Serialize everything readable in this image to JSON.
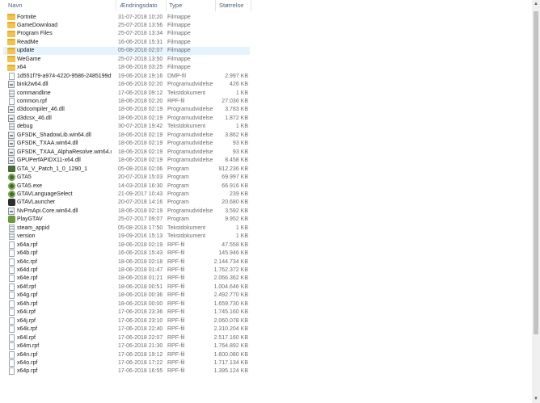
{
  "columns": {
    "name": "Navn",
    "date": "Ændringsdato",
    "type": "Type",
    "size": "Størrelse"
  },
  "files": [
    {
      "name": "Fortnite",
      "date": "31-07-2018 10:20",
      "type": "Filmappe",
      "size": "",
      "icon": "folder-icon"
    },
    {
      "name": "GameDownload",
      "date": "25-07-2018 13:56",
      "type": "Filmappe",
      "size": "",
      "icon": "folder-icon"
    },
    {
      "name": "Program Files",
      "date": "25-07-2018 13:34",
      "type": "Filmappe",
      "size": "",
      "icon": "folder-icon"
    },
    {
      "name": "ReadMe",
      "date": "16-06-2018 15:31",
      "type": "Filmappe",
      "size": "",
      "icon": "folder-icon"
    },
    {
      "name": "update",
      "date": "05-08-2018 02:07",
      "type": "Filmappe",
      "size": "",
      "icon": "folder-icon",
      "selected": true
    },
    {
      "name": "WeGame",
      "date": "25-07-2018 13:50",
      "type": "Filmappe",
      "size": "",
      "icon": "folder-icon"
    },
    {
      "name": "x64",
      "date": "18-06-2018 03:25",
      "type": "Filmappe",
      "size": "",
      "icon": "folder-icon"
    },
    {
      "name": "1d551f79-a974-4220-9586-2485199df9e2...",
      "date": "19-06-2018 19:16",
      "type": "DMP-fil",
      "size": "2.997 KB",
      "icon": "file-icon"
    },
    {
      "name": "bink2w64.dll",
      "date": "18-06-2018 02:20",
      "type": "Programudvidelse",
      "size": "426 KB",
      "icon": "dll-icon"
    },
    {
      "name": "commandline",
      "date": "17-06-2018 09:12",
      "type": "Tekstdokument",
      "size": "1 KB",
      "icon": "text-file-icon"
    },
    {
      "name": "common.rpf",
      "date": "18-06-2018 02:20",
      "type": "RPF-fil",
      "size": "27.036 KB",
      "icon": "file-icon"
    },
    {
      "name": "d3dcompiler_46.dll",
      "date": "18-06-2018 02:19",
      "type": "Programudvidelse",
      "size": "3.783 KB",
      "icon": "dll-icon"
    },
    {
      "name": "d3dcsx_46.dll",
      "date": "18-06-2018 02:19",
      "type": "Programudvidelse",
      "size": "1.872 KB",
      "icon": "dll-icon"
    },
    {
      "name": "debug",
      "date": "30-07-2018 19:42",
      "type": "Tekstdokument",
      "size": "1 KB",
      "icon": "text-file-icon"
    },
    {
      "name": "GFSDK_ShadowLib.win64.dll",
      "date": "18-06-2018 02:19",
      "type": "Programudvidelse",
      "size": "3.862 KB",
      "icon": "dll-icon"
    },
    {
      "name": "GFSDK_TXAA.win64.dll",
      "date": "18-06-2018 02:19",
      "type": "Programudvidelse",
      "size": "93 KB",
      "icon": "dll-icon"
    },
    {
      "name": "GFSDK_TXAA_AlphaResolve.win64.dll",
      "date": "18-06-2018 02:19",
      "type": "Programudvidelse",
      "size": "93 KB",
      "icon": "dll-icon"
    },
    {
      "name": "GPUPerfAPIDX11-x64.dll",
      "date": "18-06-2018 02:19",
      "type": "Programudvidelse",
      "size": "8.458 KB",
      "icon": "dll-icon"
    },
    {
      "name": "GTA_V_Patch_1_0_1290_1",
      "date": "05-08-2018 02:06",
      "type": "Program",
      "size": "912.236 KB",
      "icon": "exe-icon"
    },
    {
      "name": "GTA5",
      "date": "20-07-2018 15:03",
      "type": "Program",
      "size": "69.997 KB",
      "icon": "gta5-icon"
    },
    {
      "name": "GTA5.exe",
      "date": "14-03-2018 16:30",
      "type": "Program",
      "size": "66.916 KB",
      "icon": "gta5-icon"
    },
    {
      "name": "GTAVLanguageSelect",
      "date": "21-09-2017 10:43",
      "type": "Program",
      "size": "239 KB",
      "icon": "gta5-icon"
    },
    {
      "name": "GTAVLauncher",
      "date": "20-07-2018 14:16",
      "type": "Program",
      "size": "20.680 KB",
      "icon": "launcher-icon"
    },
    {
      "name": "NvPmApi.Core.win64.dll",
      "date": "18-06-2018 02:19",
      "type": "Programudvidelse",
      "size": "3.592 KB",
      "icon": "dll-icon"
    },
    {
      "name": "PlayGTAV",
      "date": "25-07-2017 09:07",
      "type": "Program",
      "size": "9.952 KB",
      "icon": "play-icon"
    },
    {
      "name": "steam_appid",
      "date": "05-08-2018 17:50",
      "type": "Tekstdokument",
      "size": "1 KB",
      "icon": "text-file-icon"
    },
    {
      "name": "version",
      "date": "19-09-2016 15:13",
      "type": "Tekstdokument",
      "size": "1 KB",
      "icon": "text-file-icon"
    },
    {
      "name": "x64a.rpf",
      "date": "18-06-2018 02:19",
      "type": "RPF-fil",
      "size": "47.558 KB",
      "icon": "file-icon"
    },
    {
      "name": "x64b.rpf",
      "date": "16-06-2018 15:43",
      "type": "RPF-fil",
      "size": "145.946 KB",
      "icon": "file-icon"
    },
    {
      "name": "x64c.rpf",
      "date": "18-06-2018 02:18",
      "type": "RPF-fil",
      "size": "2.144.734 KB",
      "icon": "file-icon"
    },
    {
      "name": "x64d.rpf",
      "date": "18-06-2018 01:47",
      "type": "RPF-fil",
      "size": "1.762.372 KB",
      "icon": "file-icon"
    },
    {
      "name": "x64e.rpf",
      "date": "18-06-2018 01:21",
      "type": "RPF-fil",
      "size": "2.066.362 KB",
      "icon": "file-icon"
    },
    {
      "name": "x64f.rpf",
      "date": "18-06-2018 00:51",
      "type": "RPF-fil",
      "size": "1.004.646 KB",
      "icon": "file-icon"
    },
    {
      "name": "x64g.rpf",
      "date": "18-06-2018 00:36",
      "type": "RPF-fil",
      "size": "2.492.770 KB",
      "icon": "file-icon"
    },
    {
      "name": "x64h.rpf",
      "date": "18-06-2018 00:00",
      "type": "RPF-fil",
      "size": "1.659.730 KB",
      "icon": "file-icon"
    },
    {
      "name": "x64i.rpf",
      "date": "17-06-2018 23:36",
      "type": "RPF-fil",
      "size": "1.745.160 KB",
      "icon": "file-icon"
    },
    {
      "name": "x64j.rpf",
      "date": "17-06-2018 23:10",
      "type": "RPF-fil",
      "size": "2.060.078 KB",
      "icon": "file-icon"
    },
    {
      "name": "x64k.rpf",
      "date": "17-06-2018 22:40",
      "type": "RPF-fil",
      "size": "2.310.204 KB",
      "icon": "file-icon"
    },
    {
      "name": "x64l.rpf",
      "date": "17-06-2018 22:07",
      "type": "RPF-fil",
      "size": "2.517.160 KB",
      "icon": "file-icon"
    },
    {
      "name": "x64m.rpf",
      "date": "17-06-2018 21:30",
      "type": "RPF-fil",
      "size": "1.764.892 KB",
      "icon": "file-icon"
    },
    {
      "name": "x64n.rpf",
      "date": "17-06-2018 19:12",
      "type": "RPF-fil",
      "size": "1.600.080 KB",
      "icon": "file-icon"
    },
    {
      "name": "x64o.rpf",
      "date": "17-06-2018 17:22",
      "type": "RPF-fil",
      "size": "1.717.134 KB",
      "icon": "file-icon"
    },
    {
      "name": "x64p.rpf",
      "date": "17-06-2018 16:55",
      "type": "RPF-fil",
      "size": "1.395.124 KB",
      "icon": "file-icon"
    }
  ],
  "colors": {
    "selected_row": "#e5f3ff",
    "header_text": "#4d6082",
    "folder": "#f1c34b"
  }
}
